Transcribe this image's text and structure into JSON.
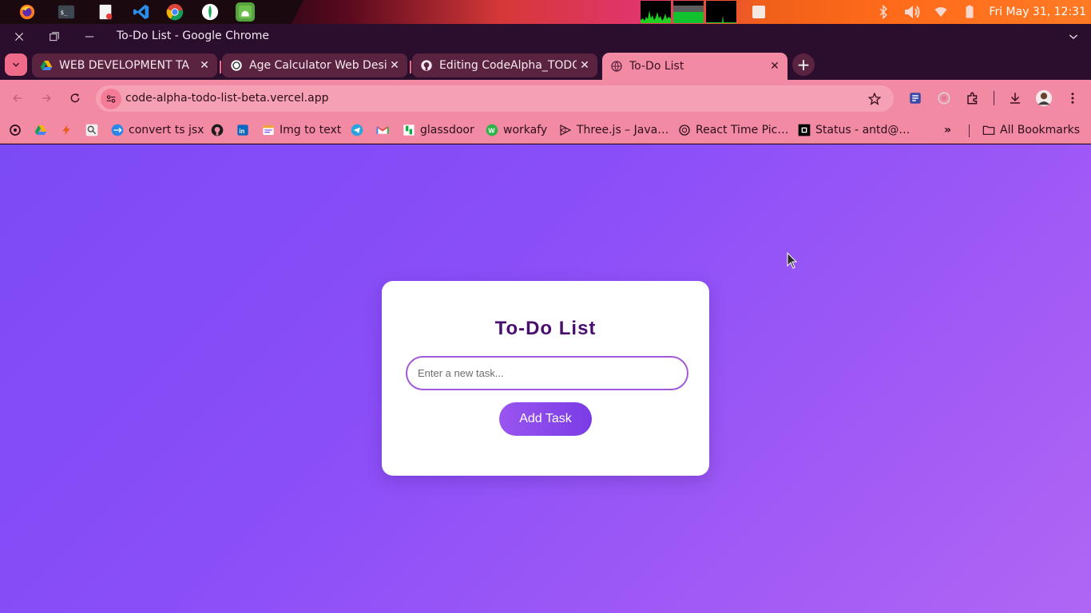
{
  "system": {
    "clock": "Fri May 31, 12:31",
    "dock_apps": [
      "firefox-icon",
      "terminal-icon",
      "text-editor-icon",
      "vscode-icon",
      "chrome-icon",
      "mongodb-compass-icon",
      "android-studio-icon"
    ]
  },
  "window": {
    "title": "To-Do List - Google Chrome"
  },
  "tabs": [
    {
      "label": "WEB DEVELOPMENT TA",
      "favicon": "google-drive-icon"
    },
    {
      "label": "Age Calculator Web Desi",
      "favicon": "chatgpt-icon"
    },
    {
      "label": "Editing CodeAlpha_TODO",
      "favicon": "github-icon"
    },
    {
      "label": "To-Do List",
      "favicon": "globe-icon",
      "active": true
    }
  ],
  "toolbar": {
    "url": "code-alpha-todo-list-beta.vercel.app"
  },
  "bookmarks": {
    "items": [
      {
        "label": "",
        "icon": "chatgpt-icon"
      },
      {
        "label": "",
        "icon": "google-drive-icon"
      },
      {
        "label": "",
        "icon": "lightning-icon"
      },
      {
        "label": "",
        "icon": "search-icon"
      },
      {
        "label": "convert ts jsx",
        "icon": "transform-icon"
      },
      {
        "label": "",
        "icon": "github-icon"
      },
      {
        "label": "",
        "icon": "linkedin-icon"
      },
      {
        "label": "Img to text",
        "icon": "image-icon"
      },
      {
        "label": "",
        "icon": "telegram-icon"
      },
      {
        "label": "",
        "icon": "gmail-icon"
      },
      {
        "label": "glassdoor",
        "icon": "glassdoor-icon"
      },
      {
        "label": "workafy",
        "icon": "workafy-icon"
      },
      {
        "label": "Three.js – Java…",
        "icon": "threejs-icon"
      },
      {
        "label": "React Time Pic…",
        "icon": "clock-icon"
      },
      {
        "label": "Status - antd@…",
        "icon": "status-icon"
      }
    ],
    "all_label": "All Bookmarks"
  },
  "app": {
    "title": "To-Do List",
    "input_placeholder": "Enter a new task...",
    "input_value": "",
    "add_button_label": "Add Task"
  },
  "colors": {
    "page_gradient_start": "#7c4af5",
    "page_gradient_end": "#b066f4",
    "title_color": "#4a0f6e",
    "button_color": "#8a48ec",
    "browser_accent": "#f38aa3"
  }
}
